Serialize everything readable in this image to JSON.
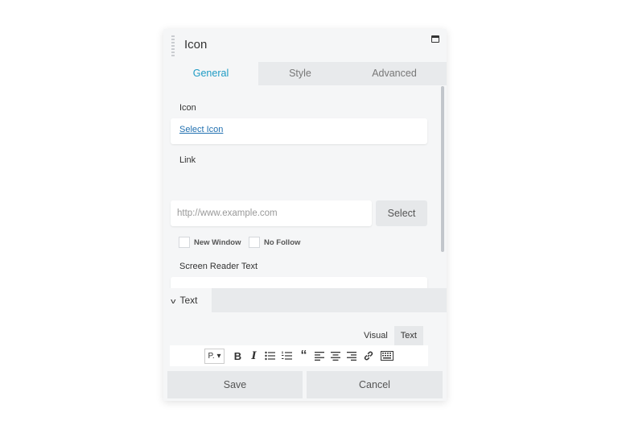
{
  "header": {
    "title": "Icon"
  },
  "tabs": [
    {
      "label": "General",
      "active": true
    },
    {
      "label": "Style",
      "active": false
    },
    {
      "label": "Advanced",
      "active": false
    }
  ],
  "icon_section": {
    "label": "Icon",
    "select_link": "Select Icon"
  },
  "link_section": {
    "label": "Link",
    "placeholder": "http://www.example.com",
    "value": "",
    "select_button": "Select",
    "new_window_label": "New Window",
    "no_follow_label": "No Follow"
  },
  "screen_reader": {
    "label": "Screen Reader Text",
    "value": ""
  },
  "text_section": {
    "label": "Text"
  },
  "editor": {
    "visual_tab": "Visual",
    "text_tab": "Text",
    "format_label": "P.",
    "toolbar_icons": [
      "format-select",
      "bold-icon",
      "italic-icon",
      "bullet-list-icon",
      "numbered-list-icon",
      "blockquote-icon",
      "align-left-icon",
      "align-center-icon",
      "align-right-icon",
      "link-icon",
      "keyboard-icon"
    ]
  },
  "footer": {
    "save_label": "Save",
    "cancel_label": "Cancel"
  },
  "colors": {
    "accent": "#1e9bc4",
    "link": "#2271b1",
    "panel_bg": "#f5f6f7"
  }
}
